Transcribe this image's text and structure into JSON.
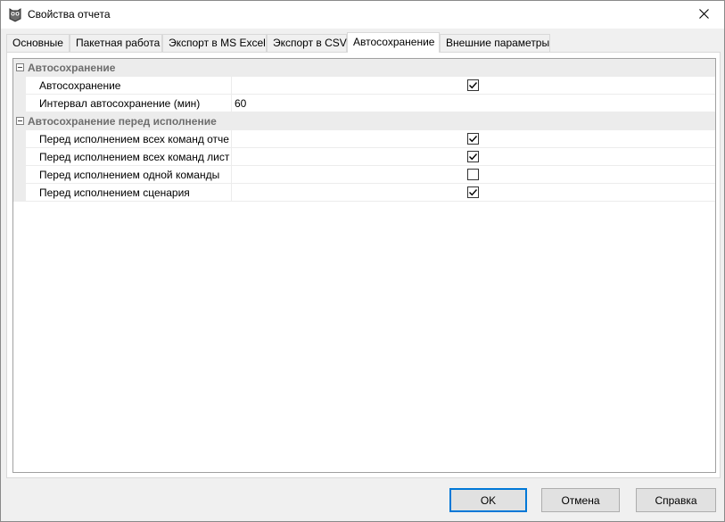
{
  "window": {
    "title": "Свойства отчета"
  },
  "tabs": [
    {
      "label": "Основные",
      "active": false
    },
    {
      "label": "Пакетная работа",
      "active": false
    },
    {
      "label": "Экспорт в MS Excel",
      "active": false
    },
    {
      "label": "Экспорт в CSV",
      "active": false
    },
    {
      "label": "Автосохранение",
      "active": true
    },
    {
      "label": "Внешние параметры",
      "active": false
    }
  ],
  "grid": {
    "categories": [
      {
        "label": "Автосохранение",
        "properties": [
          {
            "name": "Автосохранение",
            "type": "checkbox",
            "checked": true
          },
          {
            "name": "Интервал автосохранение (мин)",
            "type": "text",
            "value": "60"
          }
        ]
      },
      {
        "label": "Автосохранение перед исполнение",
        "properties": [
          {
            "name": "Перед исполнением всех команд отче",
            "type": "checkbox",
            "checked": true
          },
          {
            "name": "Перед исполнением всех команд лист",
            "type": "checkbox",
            "checked": true
          },
          {
            "name": "Перед исполнением одной команды",
            "type": "checkbox",
            "checked": false
          },
          {
            "name": "Перед исполнением сценария",
            "type": "checkbox",
            "checked": true
          }
        ]
      }
    ]
  },
  "buttons": {
    "ok": "OK",
    "cancel": "Отмена",
    "help": "Справка"
  },
  "colors": {
    "accent": "#0078d7",
    "category_bg": "#ececec",
    "category_text": "#6d6d6d"
  }
}
